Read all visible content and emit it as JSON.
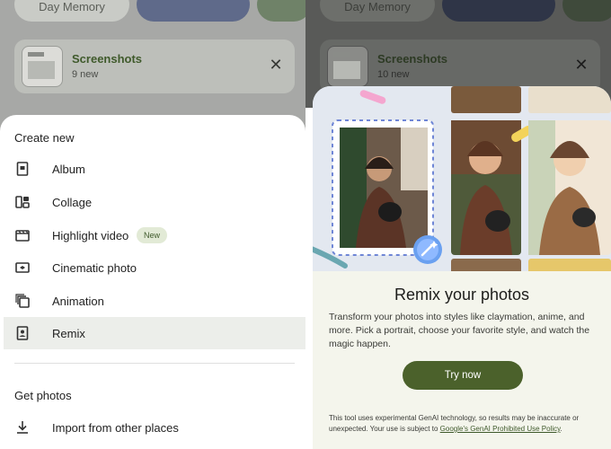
{
  "left": {
    "top_chip": "Day Memory",
    "screenshots_card": {
      "title": "Screenshots",
      "count": "9 new"
    },
    "create_new": {
      "title": "Create new",
      "items": [
        {
          "label": "Album",
          "icon": "album-icon"
        },
        {
          "label": "Collage",
          "icon": "collage-icon"
        },
        {
          "label": "Highlight video",
          "icon": "highlight-video-icon",
          "badge": "New"
        },
        {
          "label": "Cinematic photo",
          "icon": "cinematic-photo-icon"
        },
        {
          "label": "Animation",
          "icon": "animation-icon"
        },
        {
          "label": "Remix",
          "icon": "remix-icon",
          "selected": true
        }
      ]
    },
    "get_photos": {
      "title": "Get photos",
      "items": [
        {
          "label": "Import from other places",
          "icon": "download-icon"
        }
      ]
    }
  },
  "right": {
    "top_chip": "Day Memory",
    "screenshots_card": {
      "title": "Screenshots",
      "count": "10 new"
    },
    "remix_promo": {
      "title": "Remix your photos",
      "description": "Transform your photos into styles like claymation, anime, and more. Pick a portrait, choose your favorite style, and watch the magic happen.",
      "button": "Try now",
      "disclaimer_text": "This tool uses experimental GenAI technology, so results may be inaccurate or unexpected. Your use is subject to",
      "disclaimer_link": "Google's GenAI Prohibited Use Policy",
      "disclaimer_end": "."
    }
  },
  "colors": {
    "accent": "#4b612b",
    "accent_text": "#3f5a2b",
    "badge_bg": "#e2ead6",
    "modal_bg": "#f4f5ec"
  }
}
